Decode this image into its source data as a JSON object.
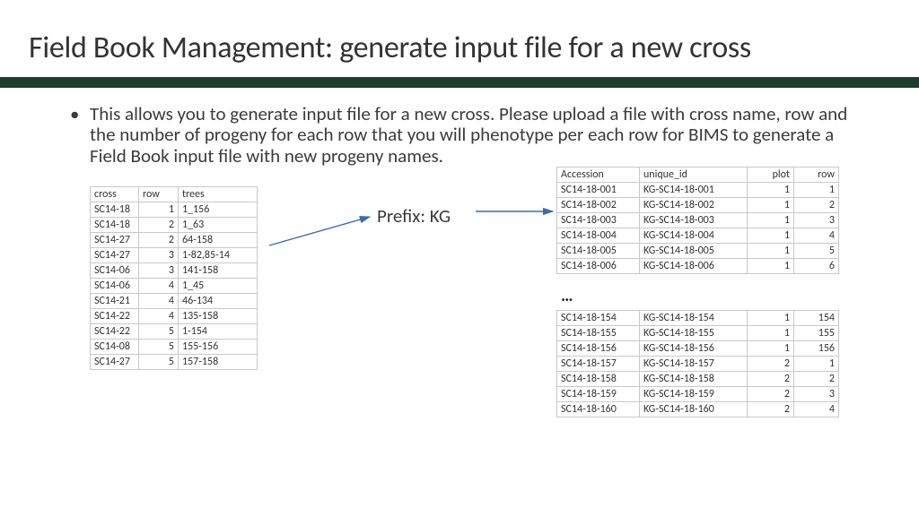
{
  "title": "Field Book Management: generate input file for a new cross",
  "paragraph": "This allows you to generate input file for a new cross. Please upload a file with cross name, row and the number of progeny for each row that you will phenotype per each row for BIMS to generate a Field Book input file with new progeny names.",
  "prefix_label": "Prefix: KG",
  "ellipsis": "…",
  "left_table": {
    "headers": {
      "c1": "cross",
      "c2": "row",
      "c3": "trees"
    },
    "rows": [
      {
        "cross": "SC14-18",
        "row": "1",
        "trees": "1_156"
      },
      {
        "cross": "SC14-18",
        "row": "2",
        "trees": "1_63"
      },
      {
        "cross": "SC14-27",
        "row": "2",
        "trees": "64-158"
      },
      {
        "cross": "SC14-27",
        "row": "3",
        "trees": "1-82,85-14"
      },
      {
        "cross": "SC14-06",
        "row": "3",
        "trees": "141-158"
      },
      {
        "cross": "SC14-06",
        "row": "4",
        "trees": "1_45"
      },
      {
        "cross": "SC14-21",
        "row": "4",
        "trees": "46-134"
      },
      {
        "cross": "SC14-22",
        "row": "4",
        "trees": "135-158"
      },
      {
        "cross": "SC14-22",
        "row": "5",
        "trees": "1-154"
      },
      {
        "cross": "SC14-08",
        "row": "5",
        "trees": "155-156"
      },
      {
        "cross": "SC14-27",
        "row": "5",
        "trees": "157-158"
      }
    ]
  },
  "right_table": {
    "headers": {
      "c1": "Accession",
      "c2": "unique_id",
      "c3": "plot",
      "c4": "row"
    },
    "top_rows": [
      {
        "acc": "SC14-18-001",
        "uid": "KG-SC14-18-001",
        "plot": "1",
        "row": "1"
      },
      {
        "acc": "SC14-18-002",
        "uid": "KG-SC14-18-002",
        "plot": "1",
        "row": "2"
      },
      {
        "acc": "SC14-18-003",
        "uid": "KG-SC14-18-003",
        "plot": "1",
        "row": "3"
      },
      {
        "acc": "SC14-18-004",
        "uid": "KG-SC14-18-004",
        "plot": "1",
        "row": "4"
      },
      {
        "acc": "SC14-18-005",
        "uid": "KG-SC14-18-005",
        "plot": "1",
        "row": "5"
      },
      {
        "acc": "SC14-18-006",
        "uid": "KG-SC14-18-006",
        "plot": "1",
        "row": "6"
      }
    ],
    "bottom_rows": [
      {
        "acc": "SC14-18-154",
        "uid": "KG-SC14-18-154",
        "plot": "1",
        "row": "154"
      },
      {
        "acc": "SC14-18-155",
        "uid": "KG-SC14-18-155",
        "plot": "1",
        "row": "155"
      },
      {
        "acc": "SC14-18-156",
        "uid": "KG-SC14-18-156",
        "plot": "1",
        "row": "156"
      },
      {
        "acc": "SC14-18-157",
        "uid": "KG-SC14-18-157",
        "plot": "2",
        "row": "1"
      },
      {
        "acc": "SC14-18-158",
        "uid": "KG-SC14-18-158",
        "plot": "2",
        "row": "2"
      },
      {
        "acc": "SC14-18-159",
        "uid": "KG-SC14-18-159",
        "plot": "2",
        "row": "3"
      },
      {
        "acc": "SC14-18-160",
        "uid": "KG-SC14-18-160",
        "plot": "2",
        "row": "4"
      }
    ]
  },
  "colors": {
    "rule": "#1d3d2f",
    "arrow": "#3c6bb3"
  }
}
